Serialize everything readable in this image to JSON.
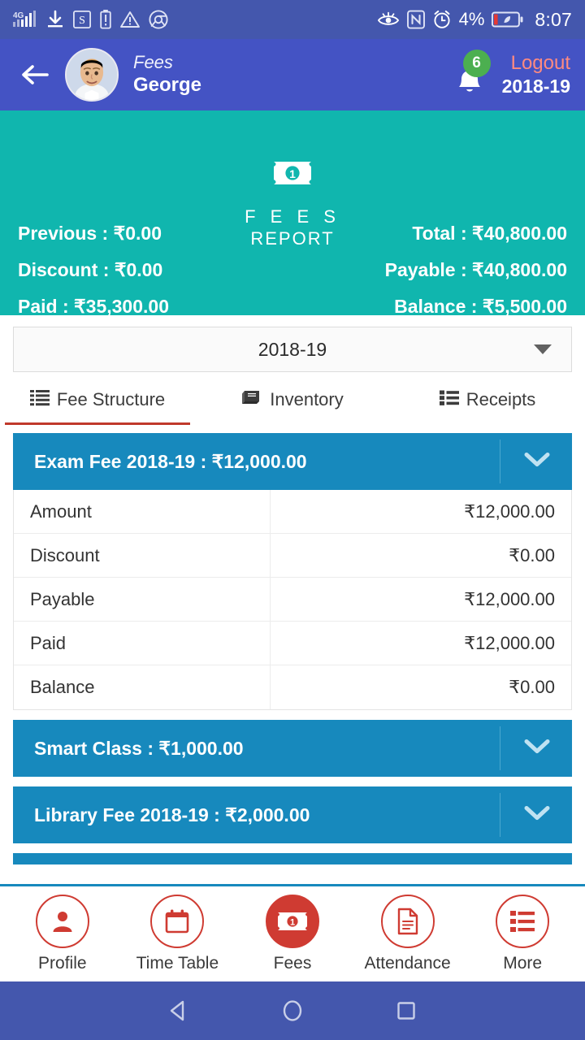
{
  "status_bar": {
    "network": "4G",
    "icons_left": [
      "signal-icon",
      "download-icon",
      "s-app-icon",
      "battery-alert-icon",
      "warning-icon",
      "chrome-icon"
    ],
    "icons_right": [
      "eye-care-icon",
      "nfc-icon",
      "alarm-icon"
    ],
    "battery_percent": "4%",
    "time": "8:07"
  },
  "app_bar": {
    "back_icon": "back-arrow-icon",
    "avatar": "student-avatar",
    "screen_label": "Fees",
    "student_name": "George",
    "notification_count": "6",
    "logout_label": "Logout",
    "session_year": "2018-19"
  },
  "summary": {
    "icon": "banknote-icon",
    "title_line1": "F E E S",
    "title_line2": "REPORT",
    "left": [
      {
        "label": "Previous",
        "value": "₹0.00"
      },
      {
        "label": "Discount",
        "value": "₹0.00"
      },
      {
        "label": "Paid",
        "value": "₹35,300.00"
      }
    ],
    "right": [
      {
        "label": "Total",
        "value": "₹40,800.00"
      },
      {
        "label": "Payable",
        "value": "₹40,800.00"
      },
      {
        "label": "Balance",
        "value": "₹5,500.00"
      }
    ]
  },
  "year_select": {
    "selected": "2018-19"
  },
  "tabs": [
    {
      "label": "Fee Structure",
      "icon": "list-lines-icon",
      "active": true
    },
    {
      "label": "Inventory",
      "icon": "book-icon",
      "active": false
    },
    {
      "label": "Receipts",
      "icon": "list-bullets-icon",
      "active": false
    }
  ],
  "fee_cards": [
    {
      "title": "Exam Fee 2018-19 : ₹12,000.00",
      "expanded": true,
      "rows": [
        {
          "key": "Amount",
          "value": "₹12,000.00"
        },
        {
          "key": "Discount",
          "value": "₹0.00"
        },
        {
          "key": "Payable",
          "value": "₹12,000.00"
        },
        {
          "key": "Paid",
          "value": "₹12,000.00"
        },
        {
          "key": "Balance",
          "value": "₹0.00"
        }
      ]
    },
    {
      "title": "Smart Class : ₹1,000.00",
      "expanded": false,
      "rows": []
    },
    {
      "title": "Library Fee 2018-19 : ₹2,000.00",
      "expanded": false,
      "rows": []
    }
  ],
  "bottom_nav": [
    {
      "label": "Profile",
      "icon": "person-icon",
      "active": false
    },
    {
      "label": "Time Table",
      "icon": "calendar-icon",
      "active": false
    },
    {
      "label": "Fees",
      "icon": "banknote-icon",
      "active": true
    },
    {
      "label": "Attendance",
      "icon": "document-icon",
      "active": false
    },
    {
      "label": "More",
      "icon": "list-bullets-icon",
      "active": false
    }
  ],
  "system_nav": {
    "back": "triangle-back-icon",
    "home": "circle-home-icon",
    "recents": "square-recents-icon"
  },
  "colors": {
    "status_bar": "#4457ad",
    "app_bar": "#4453c4",
    "summary_teal": "#10b6ae",
    "card_blue": "#1789bd",
    "accent_red": "#cf3b32",
    "logout_red": "#ff8a80",
    "badge_green": "#4caf50"
  }
}
